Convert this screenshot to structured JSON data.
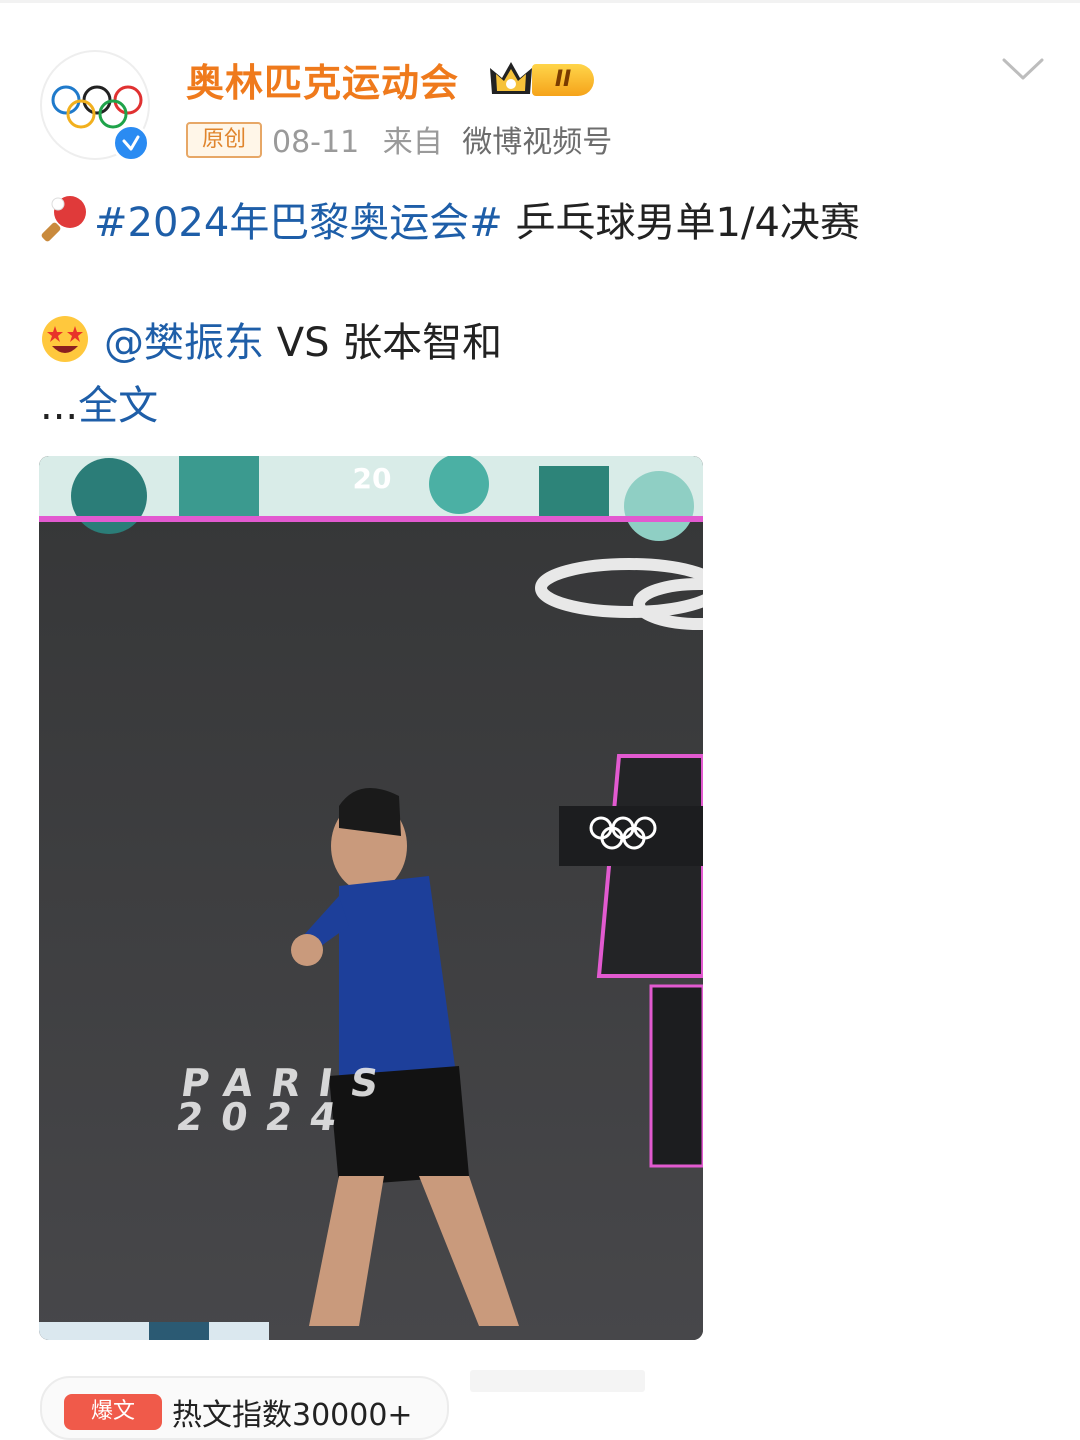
{
  "author": {
    "name": "奥林匹克运动会",
    "vip_level": "II"
  },
  "meta": {
    "badge": "原创",
    "date": "08-11",
    "source_prefix": "来自",
    "source": "微博视频号"
  },
  "content": {
    "hashtag": "#2024年巴黎奥运会#",
    "headline": "乒乓球男单1/4决赛",
    "mention": "@樊振东",
    "versus_text": "VS 张本智和",
    "ellipsis": "...",
    "expand_label": "全文"
  },
  "video": {
    "jersey_number": "20",
    "floor_text_line1": "PARIS",
    "floor_text_line2": "2024"
  },
  "hot": {
    "tag": "爆文",
    "text": "热文指数30000+"
  },
  "colors": {
    "name_orange": "#ef7a1c",
    "link_blue": "#1e5ea8",
    "verified_blue": "#2a8bf2",
    "court_pink": "#e25ad0"
  }
}
